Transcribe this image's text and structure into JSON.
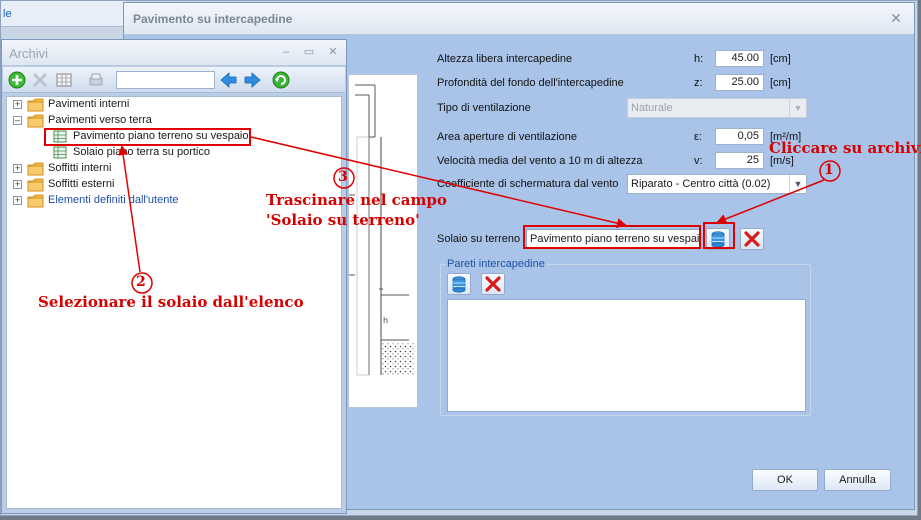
{
  "parent_window": {
    "fragment_label": "le"
  },
  "dialog": {
    "title": "Pavimento su intercapedine",
    "close_glyph": "✕",
    "fields": [
      {
        "label": "Altezza libera intercapedine",
        "symbol": "h:",
        "value": "45.00",
        "unit": "[cm]"
      },
      {
        "label": "Profondità del fondo dell'intercapedine",
        "symbol": "z:",
        "value": "25.00",
        "unit": "[cm]"
      },
      {
        "label": "Area aperture di ventilazione",
        "symbol": "ε:",
        "value": "0,05",
        "unit": "[m²/m]"
      },
      {
        "label": "Velocità media del vento a 10 m di altezza",
        "symbol": "v:",
        "value": "25",
        "unit": "[m/s]"
      }
    ],
    "tipo_ventilazione": {
      "label": "Tipo di ventilazione",
      "value": "Naturale"
    },
    "schermatura": {
      "label": "Coefficiente di schermatura dal vento",
      "value": "Riparato - Centro città (0.02)"
    },
    "solaio": {
      "label": "Solaio su terreno",
      "value": "Pavimento piano terreno su vespaio"
    },
    "pareti_group": {
      "legend": "Pareti intercapedine"
    },
    "buttons": {
      "ok": "OK",
      "cancel": "Annulla"
    }
  },
  "archivi": {
    "title": "Archivi",
    "controls": {
      "minimize": "–",
      "maximize": "▭",
      "close": "✕"
    },
    "search_value": "",
    "tree": [
      {
        "label": "Pavimenti interni",
        "expander": "+",
        "type": "folder"
      },
      {
        "label": "Pavimenti verso terra",
        "expander": "–",
        "type": "folder"
      },
      {
        "label": "Pavimento piano terreno su vespaio",
        "type": "item",
        "selected": true
      },
      {
        "label": "Solaio piano terra su portico",
        "type": "item"
      },
      {
        "label": "Soffitti interni",
        "expander": "+",
        "type": "folder"
      },
      {
        "label": "Soffitti esterni",
        "expander": "+",
        "type": "folder"
      },
      {
        "label": "Elementi definiti dall'utente",
        "expander": "+",
        "type": "folder",
        "highlight": true
      }
    ]
  },
  "annotations": {
    "step1": {
      "number": "1",
      "text": "Cliccare su archivi"
    },
    "step2": {
      "number": "2",
      "text": "Selezionare il solaio dall'elenco"
    },
    "step3": {
      "number": "3",
      "text_line1": "Trascinare nel campo",
      "text_line2": "'Solaio su terreno'"
    }
  },
  "colors": {
    "annotation_red": "#e00000",
    "link_blue": "#1c5fb8",
    "panel_blue": "#a9c4e8"
  }
}
